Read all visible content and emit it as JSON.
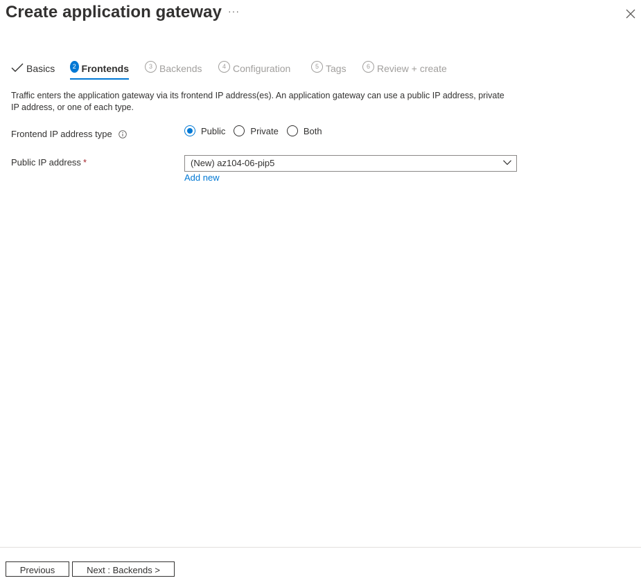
{
  "header": {
    "title": "Create application gateway",
    "more_label": "···"
  },
  "tabs": [
    {
      "number": "",
      "label": "Basics",
      "state": "done"
    },
    {
      "number": "2",
      "label": "Frontends",
      "state": "active"
    },
    {
      "number": "3",
      "label": "Backends",
      "state": "disabled"
    },
    {
      "number": "4",
      "label": "Configuration",
      "state": "disabled"
    },
    {
      "number": "5",
      "label": "Tags",
      "state": "disabled"
    },
    {
      "number": "6",
      "label": "Review + create",
      "state": "disabled"
    }
  ],
  "description": "Traffic enters the application gateway via its frontend IP address(es). An application gateway can use a public IP address, private IP address, or one of each type.",
  "frontend_ip_type": {
    "label": "Frontend IP address type",
    "options": [
      "Public",
      "Private",
      "Both"
    ],
    "selected": "Public"
  },
  "public_ip": {
    "label": "Public IP address",
    "required_mark": "*",
    "value": "(New) az104-06-pip5",
    "add_new_label": "Add new"
  },
  "footer": {
    "previous_label": "Previous",
    "next_label": "Next : Backends >"
  },
  "colors": {
    "accent": "#0078d4",
    "text": "#323130",
    "disabled": "#a19f9d",
    "required": "#a4262c"
  }
}
